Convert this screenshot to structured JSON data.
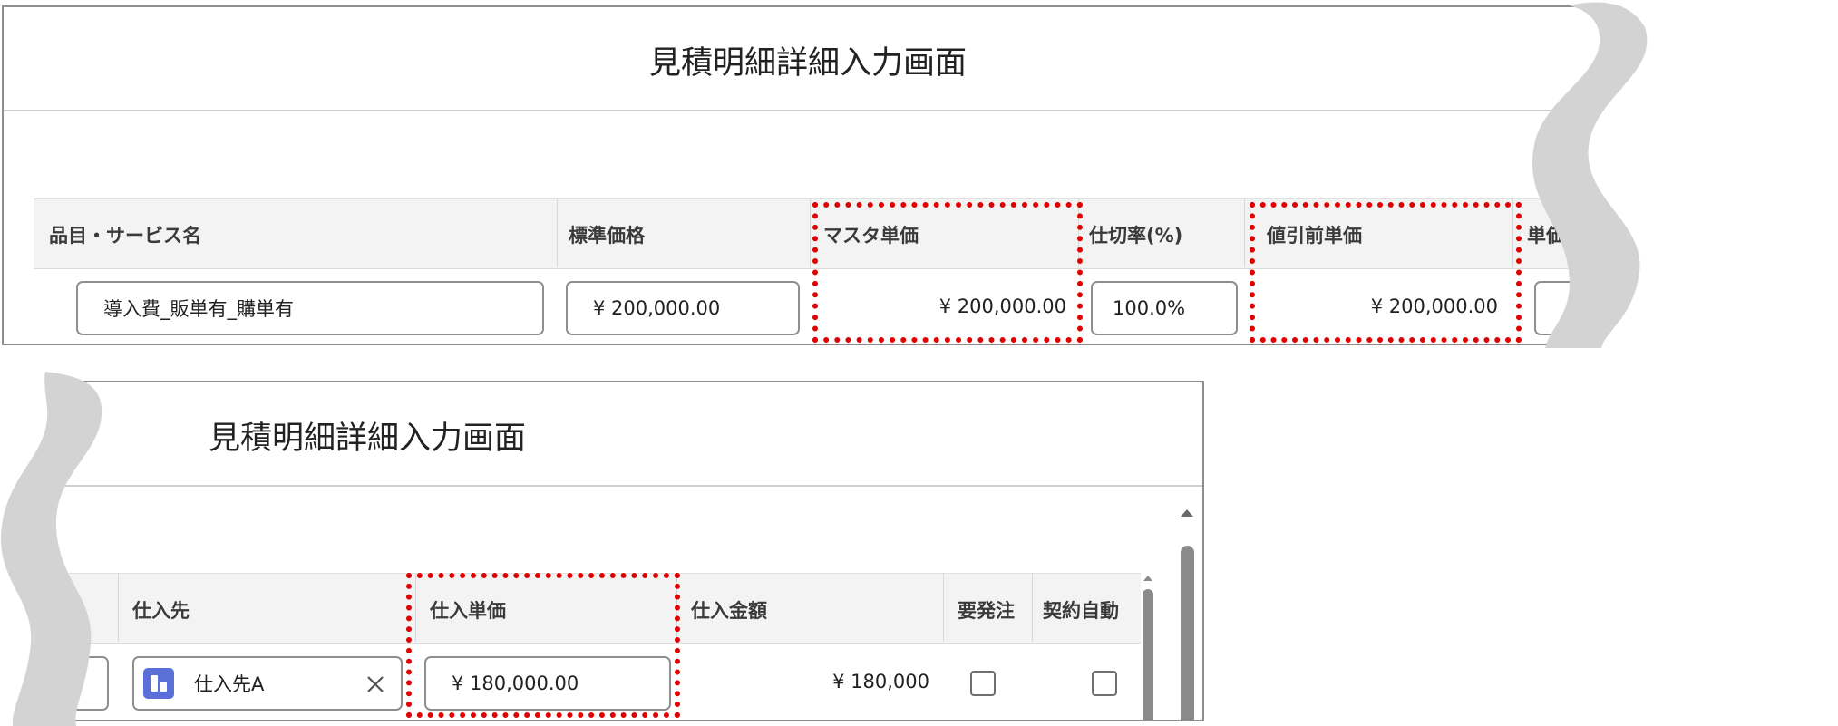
{
  "top_panel": {
    "title": "見積明細詳細入力画面",
    "columns": {
      "item_name": "品目・サービス名",
      "standard_price": "標準価格",
      "master_unit_price": "マスタ単価",
      "partition_rate": "仕切率(%)",
      "pre_discount_unit_price": "値引前単価",
      "unit_price_truncated": "単価"
    },
    "row": {
      "item_name": "導入費_販単有_購単有",
      "standard_price": "¥ 200,000.00",
      "master_unit_price": "¥ 200,000.00",
      "partition_rate": "100.0%",
      "pre_discount_unit_price": "¥ 200,000.00"
    }
  },
  "bottom_panel": {
    "title": "見積明細詳細入力画面",
    "columns": {
      "supplier": "仕入先",
      "purchase_unit_price": "仕入単価",
      "purchase_amount": "仕入金額",
      "order_required": "要発注",
      "contract_auto_truncated": "契約自動"
    },
    "row": {
      "supplier": "仕入先A",
      "purchase_unit_price": "¥ 180,000.00",
      "purchase_amount": "¥ 180,000",
      "order_required_checked": false,
      "contract_auto_checked": false
    }
  },
  "icons": {
    "supplier_icon": "record-icon",
    "clear_icon": "close-icon",
    "scroll_up": "chevron-up-icon"
  },
  "colors": {
    "highlight": "#e00000",
    "wave": "#d3d3d3",
    "lookup_icon": "#5b6fd8"
  }
}
